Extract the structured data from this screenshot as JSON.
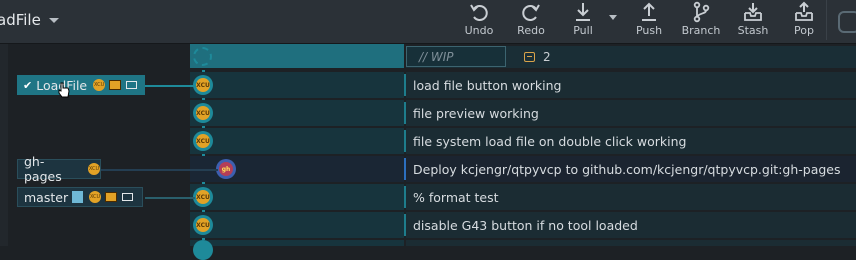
{
  "toolbar": {
    "current_branch": "adFile",
    "buttons": [
      {
        "name": "undo",
        "label": "Undo"
      },
      {
        "name": "redo",
        "label": "Redo"
      },
      {
        "name": "pull",
        "label": "Pull"
      },
      {
        "name": "push",
        "label": "Push"
      },
      {
        "name": "branch",
        "label": "Branch"
      },
      {
        "name": "stash",
        "label": "Stash"
      },
      {
        "name": "pop",
        "label": "Pop"
      }
    ]
  },
  "wip": {
    "label": "// WIP",
    "file_count": "2"
  },
  "branches": {
    "current": "LoadFile",
    "gh_pages": "gh-pages",
    "master": "master"
  },
  "commits": [
    {
      "message": "load file button working",
      "avatar": "XCU"
    },
    {
      "message": "file preview working",
      "avatar": "XCU"
    },
    {
      "message": "file system load file on double click working",
      "avatar": "XCU"
    },
    {
      "message": "Deploy kcjengr/qtpyvcp to github.com/kcjengr/qtpyvcp.git:gh-pages",
      "avatar": "gh"
    },
    {
      "message": "% format test",
      "avatar": "XCU"
    },
    {
      "message": "disable G43 button if no tool loaded",
      "avatar": "XCU"
    }
  ],
  "colors": {
    "toolbar_bg": "#2b3137",
    "graph_lane": "#1e8a9a",
    "current_branch_bg": "#1f7585",
    "deploy_lane": "#3d5fb0"
  }
}
